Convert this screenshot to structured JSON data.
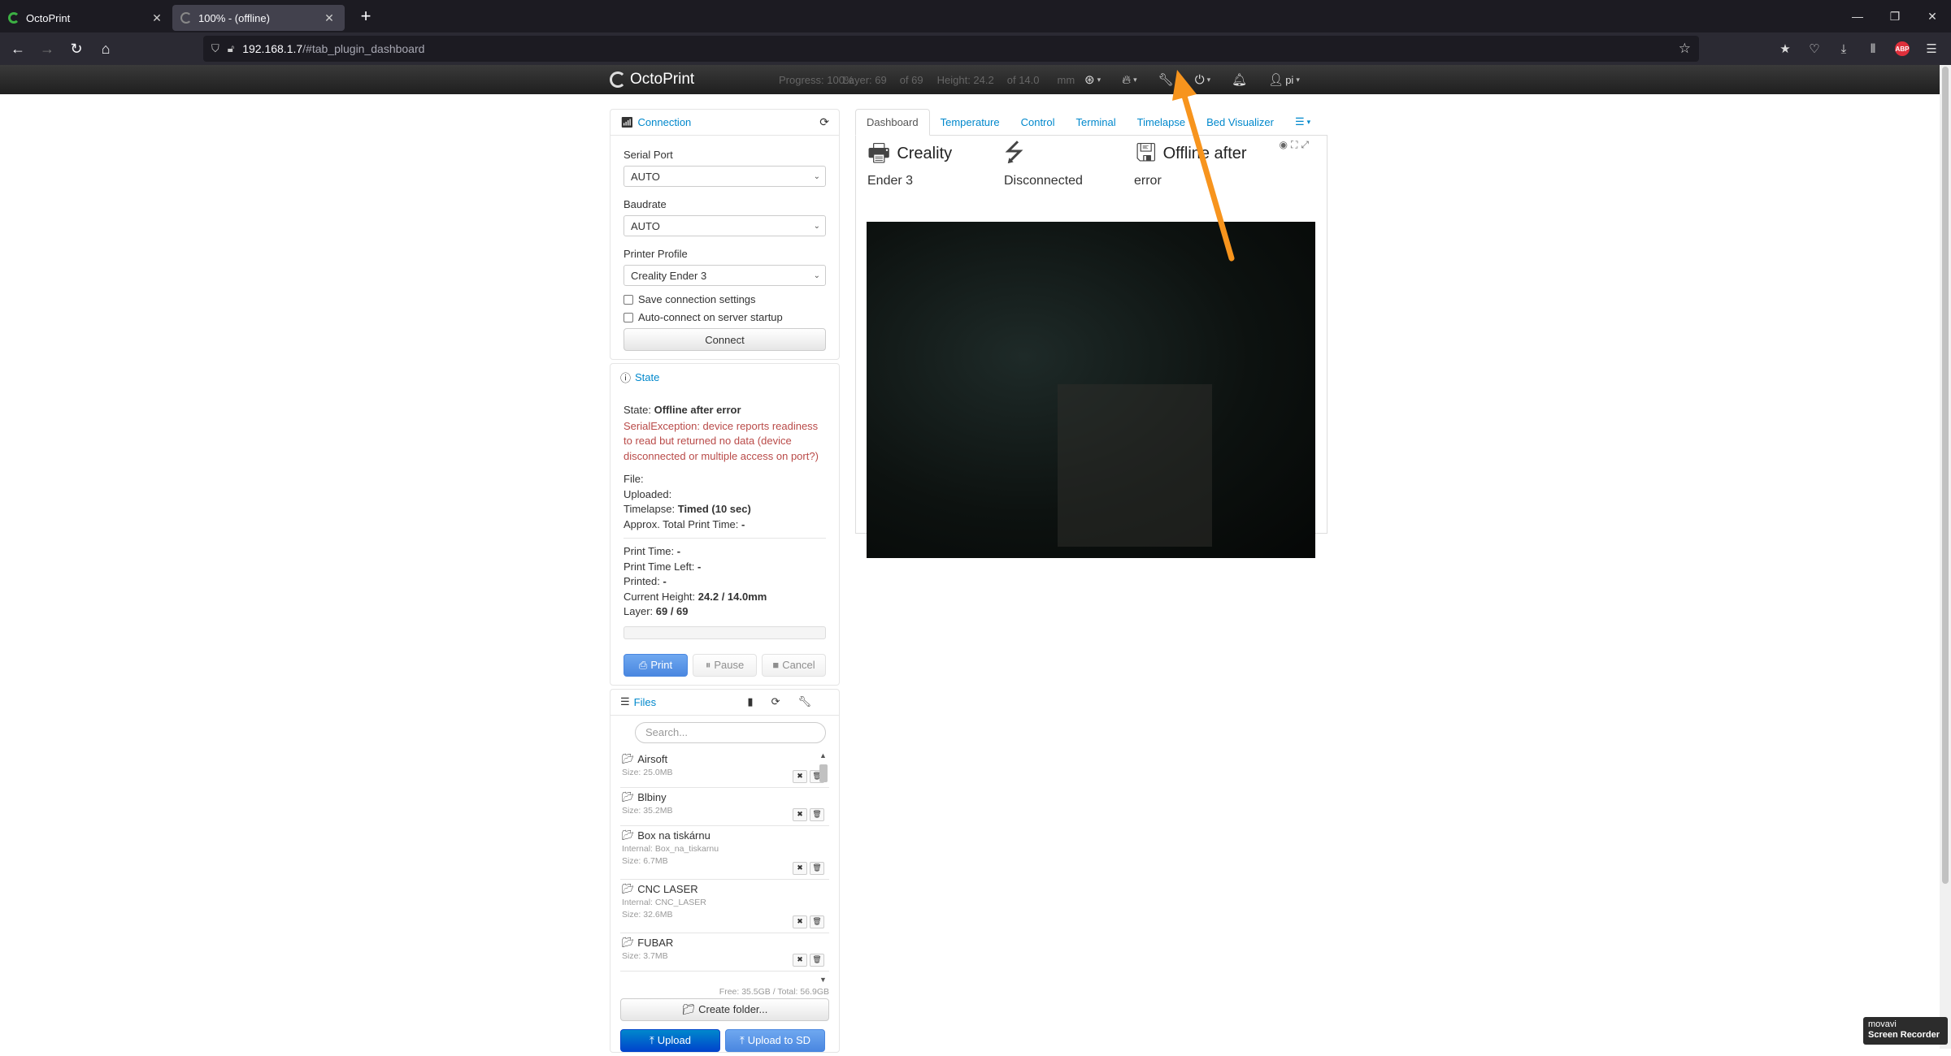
{
  "browser": {
    "tabs": [
      {
        "title": "OctoPrint",
        "active": false
      },
      {
        "title": "100% - (offline)",
        "active": true
      }
    ],
    "url_host": "192.168.1.7",
    "url_path": "/#tab_plugin_dashboard"
  },
  "header": {
    "brand": "OctoPrint",
    "status": {
      "progress": "Progress: 100%",
      "layer": "Layer: 69",
      "layer_of": "of 69",
      "height": "Height: 24.2",
      "height_of": "of 14.0",
      "unit": "mm"
    },
    "user": "pi"
  },
  "connection": {
    "title": "Connection",
    "serial_port_label": "Serial Port",
    "serial_port_value": "AUTO",
    "baudrate_label": "Baudrate",
    "baudrate_value": "AUTO",
    "profile_label": "Printer Profile",
    "profile_value": "Creality Ender 3",
    "save_settings": "Save connection settings",
    "auto_connect": "Auto-connect on server startup",
    "connect_button": "Connect"
  },
  "state": {
    "title": "State",
    "state_label": "State:",
    "state_value": "Offline after error",
    "error": "SerialException: device reports readiness to read but returned no data (device disconnected or multiple access on port?)",
    "file_label": "File:",
    "uploaded_label": "Uploaded:",
    "timelapse_label": "Timelapse:",
    "timelapse_value": "Timed (10 sec)",
    "approx_label": "Approx. Total Print Time:",
    "approx_value": "-",
    "print_time_label": "Print Time:",
    "print_time_value": "-",
    "time_left_label": "Print Time Left:",
    "time_left_value": "-",
    "printed_label": "Printed:",
    "printed_value": "-",
    "height_label": "Current Height:",
    "height_value": "24.2 / 14.0mm",
    "layer_label": "Layer:",
    "layer_value": "69 / 69",
    "print_button": "Print",
    "pause_button": "Pause",
    "cancel_button": "Cancel"
  },
  "files": {
    "title": "Files",
    "search_placeholder": "Search...",
    "items": [
      {
        "name": "Airsoft",
        "size": "Size: 25.0MB"
      },
      {
        "name": "Blbiny",
        "size": "Size: 35.2MB"
      },
      {
        "name": "Box na tiskárnu",
        "internal": "Internal: Box_na_tiskarnu",
        "size": "Size: 6.7MB"
      },
      {
        "name": "CNC LASER",
        "internal": "Internal: CNC_LASER",
        "size": "Size: 32.6MB"
      },
      {
        "name": "FUBAR",
        "size": "Size: 3.7MB"
      }
    ],
    "free_info": "Free: 35.5GB / Total: 56.9GB",
    "create_folder": "Create folder...",
    "upload": "Upload",
    "upload_sd": "Upload to SD"
  },
  "tabs": [
    "Dashboard",
    "Temperature",
    "Control",
    "Terminal",
    "Timelapse",
    "Bed Visualizer"
  ],
  "dashboard": {
    "printer_name_1": "Creality",
    "printer_name_2": "Ender 3",
    "conn_status": "Disconnected",
    "state_1": "Offline after",
    "state_2": "error"
  },
  "watermark": {
    "line1": "movavi",
    "line2": "Screen Recorder"
  },
  "colors": {
    "link": "#0088cc",
    "error": "#b94a48",
    "annotation_arrow": "#f7941d"
  }
}
